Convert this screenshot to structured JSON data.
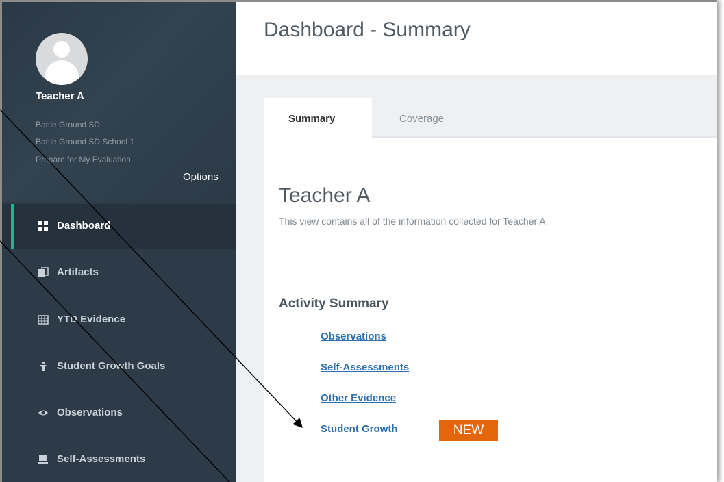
{
  "user": {
    "name": "Teacher A",
    "district": "Battle Ground SD",
    "school": "Battle Ground SD School 1",
    "mode": "Prepare for My Evaluation",
    "options_label": "Options"
  },
  "sidebar": {
    "items": [
      {
        "label": "Dashboard",
        "icon": "dashboard-icon",
        "active": true
      },
      {
        "label": "Artifacts",
        "icon": "artifacts-icon"
      },
      {
        "label": "YTD Evidence",
        "icon": "table-icon"
      },
      {
        "label": "Student Growth Goals",
        "icon": "growth-icon"
      },
      {
        "label": "Observations",
        "icon": "eye-icon"
      },
      {
        "label": "Self-Assessments",
        "icon": "self-assessment-icon"
      }
    ]
  },
  "page": {
    "title": "Dashboard - Summary"
  },
  "tabs": [
    {
      "label": "Summary",
      "active": true
    },
    {
      "label": "Coverage",
      "active": false
    }
  ],
  "summary": {
    "teacher_name": "Teacher A",
    "description": "This view contains all of the information collected for Teacher A",
    "activity_title": "Activity Summary",
    "links": [
      "Observations",
      "Self-Assessments",
      "Other Evidence",
      "Student Growth"
    ],
    "new_badge": "NEW"
  },
  "colors": {
    "sidebar": "#2d3b48",
    "accent": "#1fb58f",
    "link": "#2e6fb0",
    "badge": "#e3650c"
  }
}
